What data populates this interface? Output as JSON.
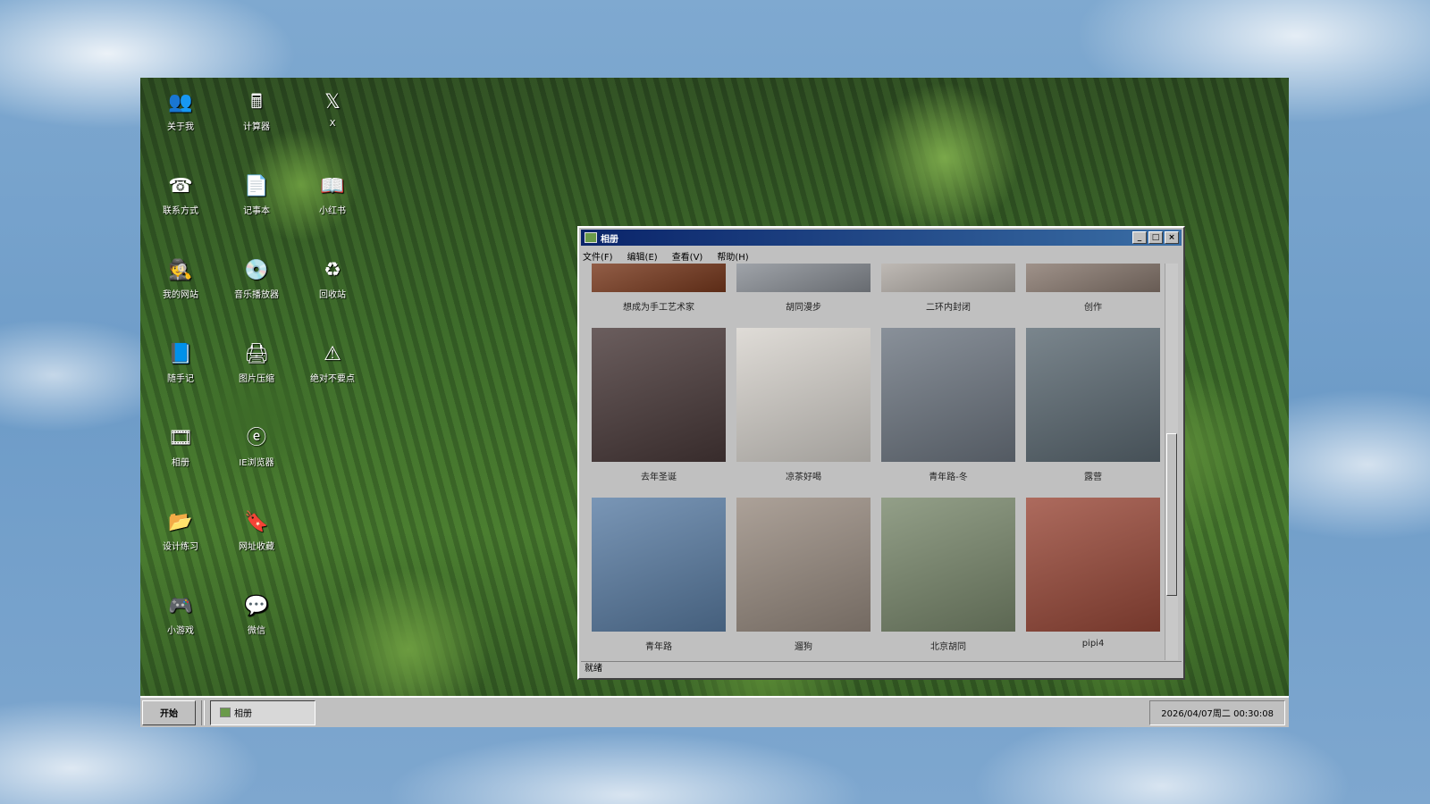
{
  "desktop": {
    "icons": [
      {
        "label": "关于我",
        "glyph": "👥"
      },
      {
        "label": "计算器",
        "glyph": "🖩"
      },
      {
        "label": "X",
        "glyph": "𝕏"
      },
      {
        "label": "联系方式",
        "glyph": "☎"
      },
      {
        "label": "记事本",
        "glyph": "📄"
      },
      {
        "label": "小红书",
        "glyph": "📖"
      },
      {
        "label": "我的网站",
        "glyph": "🕵"
      },
      {
        "label": "音乐播放器",
        "glyph": "💿"
      },
      {
        "label": "回收站",
        "glyph": "♻"
      },
      {
        "label": "随手记",
        "glyph": "📘"
      },
      {
        "label": "图片压缩",
        "glyph": "🖨"
      },
      {
        "label": "绝对不要点",
        "glyph": "⚠"
      },
      {
        "label": "相册",
        "glyph": "🎞"
      },
      {
        "label": "IE浏览器",
        "glyph": "ⓔ"
      },
      {
        "label": "设计练习",
        "glyph": "📂"
      },
      {
        "label": "网址收藏",
        "glyph": "🔖"
      },
      {
        "label": "小游戏",
        "glyph": "🎮"
      },
      {
        "label": "微信",
        "glyph": "💬"
      }
    ]
  },
  "window": {
    "title": "相册",
    "controls": {
      "minimize": "_",
      "maximize": "□",
      "close": "×"
    },
    "menu": [
      "文件(F)",
      "编辑(E)",
      "查看(V)",
      "帮助(H)"
    ],
    "status": "就绪"
  },
  "gallery": {
    "rows": [
      [
        {
          "caption": "想成为手工艺术家",
          "color": "#7a3a1e"
        },
        {
          "caption": "胡同漫步",
          "color": "#8a8f96"
        },
        {
          "caption": "二环内封闭",
          "color": "#b0aaa4"
        },
        {
          "caption": "创作",
          "color": "#8a7a70"
        }
      ],
      [
        {
          "caption": "去年圣诞",
          "color": "#4a3a3a"
        },
        {
          "caption": "凉茶好喝",
          "color": "#d8d4ce"
        },
        {
          "caption": "青年路-冬",
          "color": "#6f7883"
        },
        {
          "caption": "露营",
          "color": "#5d6b74"
        }
      ],
      [
        {
          "caption": "青年路",
          "color": "#5c7fa6"
        },
        {
          "caption": "遛狗",
          "color": "#9a8d82"
        },
        {
          "caption": "北京胡同",
          "color": "#7b8a6e"
        },
        {
          "caption": "pipi4",
          "color": "#9b4a3a"
        }
      ]
    ]
  },
  "taskbar": {
    "start_label": "开始",
    "task_label": "相册",
    "clock": "2026/04/07周二 00:30:08"
  }
}
